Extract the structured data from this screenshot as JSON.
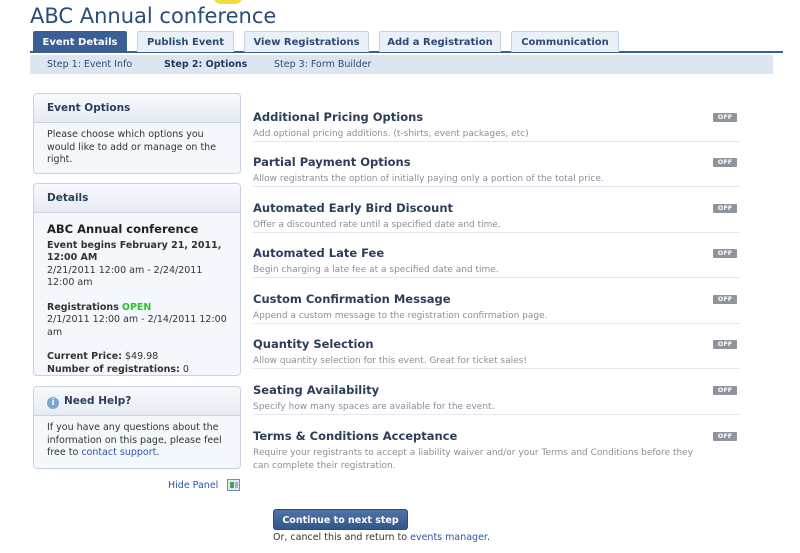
{
  "app": {
    "title": "ABC Annual conference"
  },
  "tabs": [
    {
      "label": "Event Details",
      "active": true
    },
    {
      "label": "Publish Event",
      "active": false
    },
    {
      "label": "View Registrations",
      "active": false
    },
    {
      "label": "Add a Registration",
      "active": false
    },
    {
      "label": "Communication",
      "active": false
    }
  ],
  "steps": [
    {
      "label": "Step 1: Event Info",
      "active": false
    },
    {
      "label": "Step 2: Options",
      "active": true
    },
    {
      "label": "Step 3: Form Builder",
      "active": false
    }
  ],
  "sidebar": {
    "event_options": {
      "heading": "Event Options",
      "text": "Please choose which options you would like to add or manage on the right."
    },
    "details": {
      "heading": "Details",
      "event_title": "ABC Annual conference",
      "begins_label": "Event begins February 21, 2011, 12:00 AM",
      "begins_range": "2/21/2011 12:00 am - 2/24/2011 12:00 am",
      "registrations_label": "Registrations",
      "registrations_status": "OPEN",
      "registrations_range": "2/1/2011 12:00 am - 2/14/2011 12:00 am",
      "price_label": "Current Price:",
      "price_value": "$49.98",
      "count_label": "Number of registrations:",
      "count_value": "0"
    },
    "help": {
      "icon": "info-icon",
      "heading": "Need Help?",
      "text_before": "If you have any questions about the information on this page, please feel free to",
      "link": "contact support",
      "text_after": "."
    },
    "hide_panel": "Hide Panel"
  },
  "options": [
    {
      "title": "Additional Pricing Options",
      "desc": "Add optional pricing additions. (t-shirts, event packages, etc)",
      "state": "OFF"
    },
    {
      "title": "Partial Payment Options",
      "desc": "Allow registrants the option of initially paying only a portion of the total price.",
      "state": "OFF"
    },
    {
      "title": "Automated Early Bird Discount",
      "desc": "Offer a discounted rate until a specified date and time.",
      "state": "OFF"
    },
    {
      "title": "Automated Late Fee",
      "desc": "Begin charging a late fee at a specified date and time.",
      "state": "OFF"
    },
    {
      "title": "Custom Confirmation Message",
      "desc": "Append a custom message to the registration confirmation page.",
      "state": "OFF"
    },
    {
      "title": "Quantity Selection",
      "desc": "Allow quantity selection for this event. Great for ticket sales!",
      "state": "OFF"
    },
    {
      "title": "Seating Availability",
      "desc": "Specify how many spaces are available for the event.",
      "state": "OFF"
    },
    {
      "title": "Terms & Conditions Acceptance",
      "desc": "Require your registrants to accept a liability waiver and/or your Terms and Conditions before they can complete their registration.",
      "state": "OFF"
    }
  ],
  "footer": {
    "continue_label": "Continue to next step",
    "cancel_text": "Or, cancel this and return to",
    "cancel_link": "events manager",
    "cancel_end": "."
  },
  "colors": {
    "accent": "#3a5f95",
    "open": "#2bc42b",
    "link": "#2a56a6",
    "toggle_off": "#8e949b"
  }
}
